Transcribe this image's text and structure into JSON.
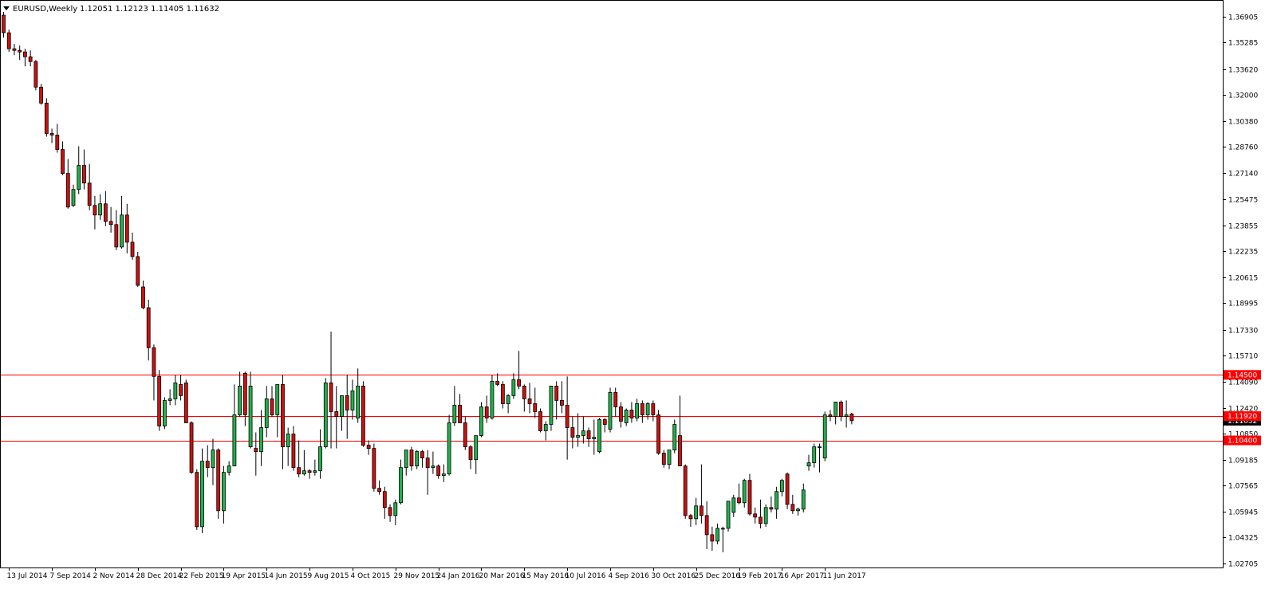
{
  "header": {
    "symbol_label": "EURUSD,Weekly",
    "ohlc": "1.12051 1.12123 1.11405 1.11632"
  },
  "chart_data": {
    "type": "candlestick",
    "symbol": "EURUSD",
    "timeframe": "Weekly",
    "ylim": [
      1.0245,
      1.3795
    ],
    "y_ticks": [
      "1.36905",
      "1.35285",
      "1.33620",
      "1.32000",
      "1.30380",
      "1.28760",
      "1.27140",
      "1.25475",
      "1.23855",
      "1.22235",
      "1.20615",
      "1.18995",
      "1.17330",
      "1.15710",
      "1.14090",
      "1.12420",
      "1.10850",
      "1.09185",
      "1.07565",
      "1.05945",
      "1.04325",
      "1.02705"
    ],
    "x_ticks": [
      "13 Jul 2014",
      "7 Sep 2014",
      "2 Nov 2014",
      "28 Dec 2014",
      "22 Feb 2015",
      "19 Apr 2015",
      "14 Jun 2015",
      "9 Aug 2015",
      "4 Oct 2015",
      "29 Nov 2015",
      "24 Jan 2016",
      "20 Mar 2016",
      "15 May 2016",
      "10 Jul 2016",
      "4 Sep 2016",
      "30 Oct 2016",
      "25 Dec 2016",
      "19 Feb 2017",
      "16 Apr 2017",
      "11 Jun 2017"
    ],
    "x_tick_index": [
      1,
      9,
      17,
      25,
      33,
      41,
      49,
      57,
      65,
      73,
      81,
      89,
      97,
      105,
      113,
      121,
      129,
      137,
      145,
      153
    ],
    "horizontal_levels": [
      {
        "label": "1.14500",
        "value": 1.145
      },
      {
        "label": "1.11920",
        "value": 1.1192
      },
      {
        "label": "1.10400",
        "value": 1.104
      }
    ],
    "current_price": {
      "label": "1.11632",
      "value": 1.11632
    },
    "colors": {
      "bull": "#22b14c",
      "bear": "#cc1111",
      "wick": "#000000",
      "level_line": "#ff0000",
      "level_tag": "#ff0000",
      "price_tag": "#000000",
      "axis": "#000000"
    },
    "candles": [
      [
        1.37,
        1.372,
        1.356,
        1.359
      ],
      [
        1.359,
        1.361,
        1.347,
        1.349
      ],
      [
        1.349,
        1.352,
        1.345,
        1.348
      ],
      [
        1.348,
        1.351,
        1.342,
        1.347
      ],
      [
        1.347,
        1.349,
        1.338,
        1.344
      ],
      [
        1.344,
        1.348,
        1.338,
        1.341
      ],
      [
        1.341,
        1.342,
        1.323,
        1.325
      ],
      [
        1.325,
        1.327,
        1.314,
        1.315
      ],
      [
        1.315,
        1.318,
        1.294,
        1.296
      ],
      [
        1.296,
        1.299,
        1.29,
        1.295
      ],
      [
        1.295,
        1.302,
        1.284,
        1.286
      ],
      [
        1.286,
        1.291,
        1.27,
        1.271
      ],
      [
        1.271,
        1.28,
        1.249,
        1.25
      ],
      [
        1.251,
        1.264,
        1.25,
        1.261
      ],
      [
        1.261,
        1.288,
        1.258,
        1.276
      ],
      [
        1.276,
        1.286,
        1.261,
        1.265
      ],
      [
        1.265,
        1.277,
        1.248,
        1.251
      ],
      [
        1.251,
        1.257,
        1.236,
        1.245
      ],
      [
        1.245,
        1.258,
        1.242,
        1.252
      ],
      [
        1.252,
        1.26,
        1.238,
        1.241
      ],
      [
        1.241,
        1.25,
        1.234,
        1.239
      ],
      [
        1.239,
        1.248,
        1.223,
        1.225
      ],
      [
        1.225,
        1.257,
        1.224,
        1.245
      ],
      [
        1.245,
        1.252,
        1.221,
        1.228
      ],
      [
        1.228,
        1.234,
        1.217,
        1.219
      ],
      [
        1.219,
        1.222,
        1.2,
        1.201
      ],
      [
        1.2,
        1.204,
        1.186,
        1.187
      ],
      [
        1.187,
        1.192,
        1.154,
        1.162
      ],
      [
        1.162,
        1.164,
        1.129,
        1.144
      ],
      [
        1.144,
        1.148,
        1.11,
        1.113
      ],
      [
        1.113,
        1.131,
        1.111,
        1.129
      ],
      [
        1.129,
        1.136,
        1.126,
        1.13
      ],
      [
        1.13,
        1.145,
        1.126,
        1.14
      ],
      [
        1.139,
        1.145,
        1.129,
        1.132
      ],
      [
        1.14,
        1.142,
        1.115,
        1.115
      ],
      [
        1.115,
        1.116,
        1.083,
        1.084
      ],
      [
        1.084,
        1.086,
        1.048,
        1.05
      ],
      [
        1.05,
        1.099,
        1.046,
        1.091
      ],
      [
        1.091,
        1.101,
        1.081,
        1.087
      ],
      [
        1.087,
        1.105,
        1.076,
        1.098
      ],
      [
        1.098,
        1.099,
        1.055,
        1.06
      ],
      [
        1.06,
        1.088,
        1.052,
        1.084
      ],
      [
        1.084,
        1.091,
        1.082,
        1.088
      ],
      [
        1.088,
        1.139,
        1.088,
        1.12
      ],
      [
        1.12,
        1.147,
        1.119,
        1.138
      ],
      [
        1.146,
        1.147,
        1.113,
        1.12
      ],
      [
        1.1,
        1.147,
        1.099,
        1.138
      ],
      [
        1.099,
        1.109,
        1.082,
        1.097
      ],
      [
        1.097,
        1.123,
        1.088,
        1.112
      ],
      [
        1.112,
        1.138,
        1.106,
        1.13
      ],
      [
        1.13,
        1.138,
        1.119,
        1.12
      ],
      [
        1.12,
        1.133,
        1.106,
        1.139
      ],
      [
        1.139,
        1.145,
        1.086,
        1.1
      ],
      [
        1.1,
        1.112,
        1.088,
        1.108
      ],
      [
        1.108,
        1.113,
        1.085,
        1.087
      ],
      [
        1.087,
        1.104,
        1.081,
        1.083
      ],
      [
        1.083,
        1.098,
        1.082,
        1.085
      ],
      [
        1.085,
        1.086,
        1.08,
        1.084
      ],
      [
        1.084,
        1.092,
        1.082,
        1.085
      ],
      [
        1.085,
        1.111,
        1.08,
        1.1
      ],
      [
        1.1,
        1.143,
        1.099,
        1.14
      ],
      [
        1.14,
        1.172,
        1.099,
        1.122
      ],
      [
        1.122,
        1.138,
        1.099,
        1.119
      ],
      [
        1.119,
        1.132,
        1.11,
        1.132
      ],
      [
        1.132,
        1.145,
        1.105,
        1.123
      ],
      [
        1.123,
        1.142,
        1.117,
        1.135
      ],
      [
        1.118,
        1.149,
        1.115,
        1.138
      ],
      [
        1.138,
        1.141,
        1.1,
        1.101
      ],
      [
        1.101,
        1.104,
        1.095,
        1.099
      ],
      [
        1.099,
        1.102,
        1.072,
        1.074
      ],
      [
        1.074,
        1.079,
        1.07,
        1.072
      ],
      [
        1.072,
        1.075,
        1.055,
        1.062
      ],
      [
        1.062,
        1.064,
        1.053,
        1.057
      ],
      [
        1.057,
        1.067,
        1.051,
        1.065
      ],
      [
        1.065,
        1.092,
        1.064,
        1.087
      ],
      [
        1.087,
        1.098,
        1.082,
        1.098
      ],
      [
        1.098,
        1.1,
        1.085,
        1.088
      ],
      [
        1.088,
        1.098,
        1.086,
        1.097
      ],
      [
        1.097,
        1.098,
        1.087,
        1.093
      ],
      [
        1.093,
        1.098,
        1.07,
        1.087
      ],
      [
        1.087,
        1.097,
        1.083,
        1.088
      ],
      [
        1.088,
        1.089,
        1.08,
        1.082
      ],
      [
        1.082,
        1.089,
        1.078,
        1.083
      ],
      [
        1.083,
        1.12,
        1.082,
        1.115
      ],
      [
        1.115,
        1.138,
        1.113,
        1.126
      ],
      [
        1.126,
        1.133,
        1.117,
        1.115
      ],
      [
        1.115,
        1.119,
        1.098,
        1.1
      ],
      [
        1.1,
        1.101,
        1.086,
        1.092
      ],
      [
        1.092,
        1.107,
        1.083,
        1.107
      ],
      [
        1.107,
        1.128,
        1.106,
        1.125
      ],
      [
        1.125,
        1.132,
        1.115,
        1.118
      ],
      [
        1.118,
        1.145,
        1.117,
        1.141
      ],
      [
        1.141,
        1.146,
        1.138,
        1.139
      ],
      [
        1.139,
        1.141,
        1.124,
        1.127
      ],
      [
        1.127,
        1.133,
        1.121,
        1.132
      ],
      [
        1.132,
        1.146,
        1.13,
        1.142
      ],
      [
        1.142,
        1.16,
        1.136,
        1.138
      ],
      [
        1.138,
        1.139,
        1.122,
        1.13
      ],
      [
        1.13,
        1.14,
        1.121,
        1.127
      ],
      [
        1.127,
        1.137,
        1.118,
        1.122
      ],
      [
        1.122,
        1.124,
        1.109,
        1.11
      ],
      [
        1.11,
        1.116,
        1.104,
        1.114
      ],
      [
        1.114,
        1.138,
        1.11,
        1.138
      ],
      [
        1.138,
        1.141,
        1.117,
        1.129
      ],
      [
        1.129,
        1.141,
        1.121,
        1.126
      ],
      [
        1.126,
        1.144,
        1.092,
        1.112
      ],
      [
        1.112,
        1.119,
        1.099,
        1.106
      ],
      [
        1.106,
        1.121,
        1.1,
        1.107
      ],
      [
        1.107,
        1.119,
        1.102,
        1.11
      ],
      [
        1.11,
        1.112,
        1.1,
        1.105
      ],
      [
        1.105,
        1.117,
        1.095,
        1.106
      ],
      [
        1.097,
        1.118,
        1.096,
        1.117
      ],
      [
        1.117,
        1.118,
        1.109,
        1.114
      ],
      [
        1.111,
        1.137,
        1.109,
        1.134
      ],
      [
        1.134,
        1.137,
        1.119,
        1.125
      ],
      [
        1.125,
        1.128,
        1.112,
        1.116
      ],
      [
        1.115,
        1.124,
        1.113,
        1.123
      ],
      [
        1.123,
        1.128,
        1.115,
        1.118
      ],
      [
        1.118,
        1.13,
        1.116,
        1.127
      ],
      [
        1.127,
        1.129,
        1.115,
        1.12
      ],
      [
        1.12,
        1.128,
        1.117,
        1.127
      ],
      [
        1.127,
        1.129,
        1.116,
        1.12
      ],
      [
        1.12,
        1.123,
        1.095,
        1.096
      ],
      [
        1.096,
        1.098,
        1.087,
        1.089
      ],
      [
        1.089,
        1.098,
        1.086,
        1.098
      ],
      [
        1.098,
        1.117,
        1.096,
        1.114
      ],
      [
        1.107,
        1.132,
        1.088,
        1.088
      ],
      [
        1.088,
        1.089,
        1.055,
        1.057
      ],
      [
        1.057,
        1.058,
        1.05,
        1.055
      ],
      [
        1.055,
        1.068,
        1.051,
        1.063
      ],
      [
        1.063,
        1.089,
        1.052,
        1.057
      ],
      [
        1.057,
        1.066,
        1.036,
        1.045
      ],
      [
        1.045,
        1.05,
        1.035,
        1.041
      ],
      [
        1.041,
        1.052,
        1.039,
        1.049
      ],
      [
        1.049,
        1.05,
        1.034,
        1.049
      ],
      [
        1.049,
        1.066,
        1.047,
        1.066
      ],
      [
        1.059,
        1.07,
        1.056,
        1.068
      ],
      [
        1.068,
        1.077,
        1.064,
        1.065
      ],
      [
        1.065,
        1.08,
        1.062,
        1.079
      ],
      [
        1.079,
        1.083,
        1.057,
        1.058
      ],
      [
        1.058,
        1.062,
        1.052,
        1.056
      ],
      [
        1.056,
        1.067,
        1.049,
        1.052
      ],
      [
        1.052,
        1.064,
        1.05,
        1.062
      ],
      [
        1.062,
        1.069,
        1.059,
        1.061
      ],
      [
        1.061,
        1.075,
        1.055,
        1.072
      ],
      [
        1.072,
        1.08,
        1.069,
        1.079
      ],
      [
        1.083,
        1.084,
        1.061,
        1.064
      ],
      [
        1.064,
        1.07,
        1.058,
        1.06
      ],
      [
        1.06,
        1.062,
        1.057,
        1.061
      ],
      [
        1.061,
        1.077,
        1.059,
        1.073
      ],
      [
        1.088,
        1.095,
        1.085,
        1.09
      ],
      [
        1.09,
        1.102,
        1.087,
        1.1
      ],
      [
        1.1,
        1.102,
        1.084,
        1.1
      ],
      [
        1.093,
        1.122,
        1.091,
        1.12
      ],
      [
        1.12,
        1.123,
        1.116,
        1.119
      ],
      [
        1.119,
        1.127,
        1.114,
        1.128
      ],
      [
        1.128,
        1.129,
        1.116,
        1.119
      ],
      [
        1.119,
        1.129,
        1.112,
        1.12
      ],
      [
        1.12051,
        1.12123,
        1.11405,
        1.11632
      ]
    ]
  }
}
